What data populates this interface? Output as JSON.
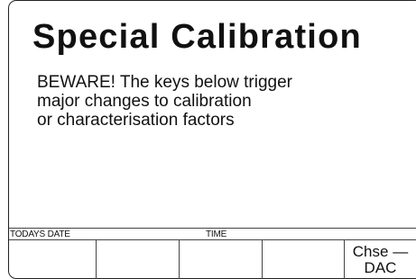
{
  "screen": {
    "title": "Special Calibration",
    "warning_lines": [
      "BEWARE! The keys below trigger",
      "major changes to calibration",
      "or characterisation factors"
    ]
  },
  "status_bar": {
    "date_label": "TODAYS DATE",
    "time_label": "TIME"
  },
  "softkeys": [
    {
      "label": ""
    },
    {
      "label": ""
    },
    {
      "label": ""
    },
    {
      "label": ""
    },
    {
      "label_line1": "Chse —",
      "label_line2": "DAC"
    }
  ]
}
